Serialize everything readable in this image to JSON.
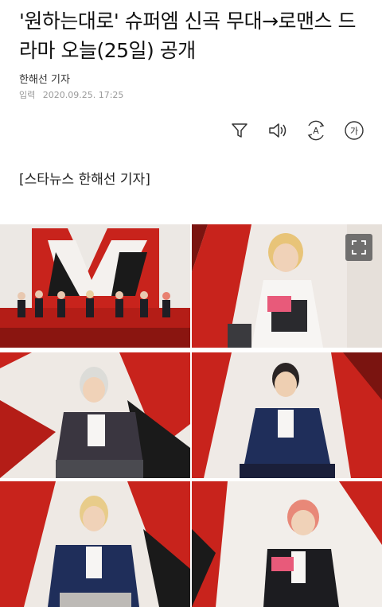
{
  "article": {
    "headline": "'원하는대로' 슈퍼엠 신곡 무대→로맨스 드라마 오늘(25일) 공개",
    "reporter": "한해선 기자",
    "date_label": "입력",
    "date_value": "2020.09.25. 17:25",
    "byline": "[스타뉴스 한해선 기자]"
  },
  "toolbar": {
    "icons": [
      "filter-icon",
      "speaker-icon",
      "font-size-icon",
      "translate-icon"
    ],
    "font_glyph": "A",
    "translate_glyph": "가"
  },
  "gallery": {
    "photo_count": 6,
    "expand_icon": "expand-icon"
  },
  "colors": {
    "accent_red": "#c8231c",
    "dark_red": "#7a1410",
    "navy": "#1f2e5a",
    "charcoal": "#2a2a2e"
  }
}
